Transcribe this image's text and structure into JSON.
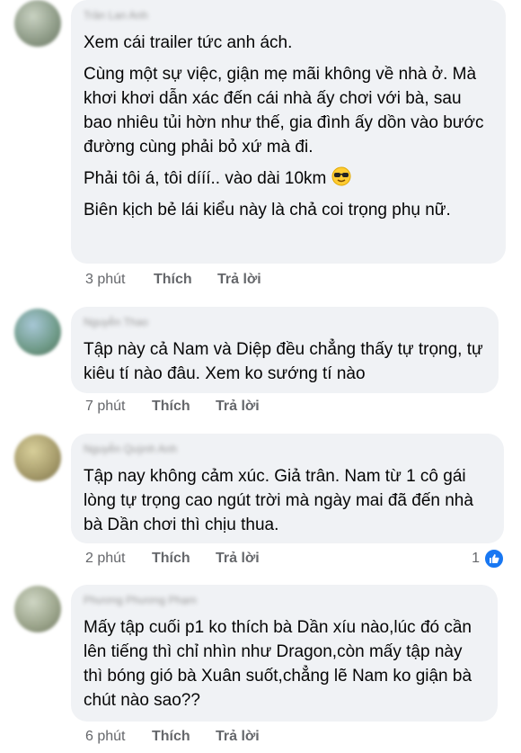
{
  "comments": [
    {
      "author": "Trần Lan Anh",
      "paragraphs": [
        "Xem cái trailer tức anh ách.",
        "Cùng một sự việc, giận mẹ mãi không về nhà ở. Mà khơi khơi dẫn xác đến cái nhà ấy chơi với bà, sau bao nhiêu tủi hờn như thế, gia đình ấy dồn vào bước đường cùng phải bỏ xứ mà đi.",
        "Phải tôi á, tôi dííí.. vào dài 10km",
        "Biên kịch bẻ lái kiểu này là chả coi trọng phụ nữ."
      ],
      "emoji": "smiling-face-with-sunglasses",
      "time": "3 phút",
      "like_label": "Thích",
      "reply_label": "Trả lời"
    },
    {
      "author": "Nguyễn Thao",
      "paragraphs": [
        "Tập này cả Nam và Diệp đều chẳng thấy tự trọng, tự kiêu tí nào đâu. Xem ko sướng tí nào"
      ],
      "time": "7 phút",
      "like_label": "Thích",
      "reply_label": "Trả lời"
    },
    {
      "author": "Nguyễn Quỳnh Anh",
      "paragraphs": [
        "Tập nay không cảm xúc. Giả trân. Nam từ 1 cô gái lòng tự trọng cao ngút trời mà ngày mai đã đến nhà bà Dần chơi thì chịu thua."
      ],
      "time": "2 phút",
      "like_label": "Thích",
      "reply_label": "Trả lời",
      "reaction_count": "1",
      "reaction_icon": "thumbs-up-icon"
    },
    {
      "author": "Phương Phương Phạm",
      "paragraphs": [
        "Mấy tập cuối p1 ko thích bà Dần xíu nào,lúc đó cần lên tiếng thì chỉ nhìn như Dragon,còn mấy tập này thì bóng gió bà Xuân suốt,chẳng lẽ Nam ko giận bà chút nào sao??"
      ],
      "time": "6 phút",
      "like_label": "Thích",
      "reply_label": "Trả lời"
    }
  ],
  "colors": {
    "bubble": "#f0f2f5",
    "text": "#050505",
    "meta": "#65676b",
    "like_blue": "#1877f2"
  }
}
